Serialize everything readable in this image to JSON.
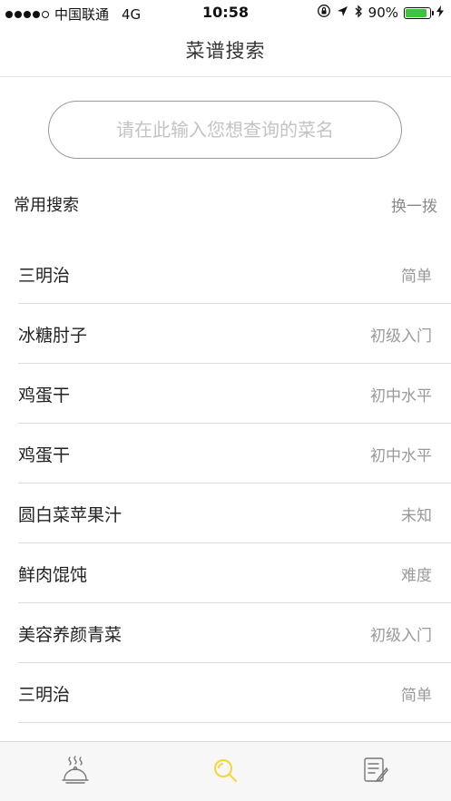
{
  "status_bar": {
    "carrier": "中国联通",
    "network": "4G",
    "time": "10:58",
    "battery_percent": "90%",
    "battery_level": 0.9,
    "battery_color": "#3fc33f"
  },
  "nav": {
    "title": "菜谱搜索"
  },
  "search": {
    "placeholder": "请在此输入您想查询的菜名",
    "value": ""
  },
  "section": {
    "title": "常用搜索",
    "refresh_label": "换一拨"
  },
  "recipes": [
    {
      "name": "三明治",
      "level": "简单"
    },
    {
      "name": "冰糖肘子",
      "level": "初级入门"
    },
    {
      "name": "鸡蛋干",
      "level": "初中水平"
    },
    {
      "name": "鸡蛋干",
      "level": "初中水平"
    },
    {
      "name": "圆白菜苹果汁",
      "level": "未知"
    },
    {
      "name": "鲜肉馄饨",
      "level": "难度"
    },
    {
      "name": "美容养颜青菜",
      "level": "初级入门"
    },
    {
      "name": "三明治",
      "level": "简单"
    }
  ],
  "tab_bar": {
    "tabs": [
      {
        "icon": "dish-cloche-icon",
        "active": false
      },
      {
        "icon": "search-icon",
        "active": true
      },
      {
        "icon": "notes-icon",
        "active": false
      }
    ],
    "active_color": "#f5d43a",
    "inactive_color": "#777777"
  }
}
